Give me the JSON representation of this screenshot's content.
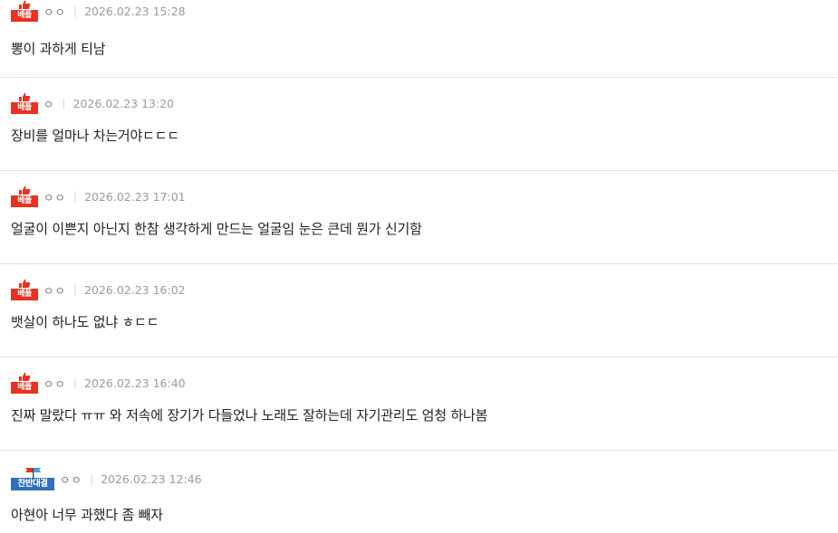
{
  "comments": [
    {
      "badge": "베플",
      "badge_type": "best",
      "nick": "ㅇㅇ",
      "date": "2026.02.23 15:28",
      "text": "뽕이 과하게 티남"
    },
    {
      "badge": "베플",
      "badge_type": "best",
      "nick": "ㅇ",
      "date": "2026.02.23 13:20",
      "text": "장비를 얼마나 차는거야ㄷㄷㄷ"
    },
    {
      "badge": "베플",
      "badge_type": "best",
      "nick": "ㅇㅇ",
      "date": "2026.02.23 17:01",
      "text": "얼굴이 이쁜지 아닌지 한참 생각하게 만드는 얼굴임 눈은 큰데 뭔가 신기함"
    },
    {
      "badge": "베플",
      "badge_type": "best",
      "nick": "ㅇㅇ",
      "date": "2026.02.23 16:02",
      "text": "뱃살이 하나도 없냐 ㅎㄷㄷ"
    },
    {
      "badge": "베플",
      "badge_type": "best",
      "nick": "ㅇㅇ",
      "date": "2026.02.23 16:40",
      "text": "진짜 말랐다 ㅠㅠ 와 저속에 장기가 다들었나 노래도 잘하는데 자기관리도 엄청 하나봄"
    },
    {
      "badge": "찬반대결",
      "badge_type": "debate",
      "nick": "ㅇㅇ",
      "date": "2026.02.23 12:46",
      "text": "아현아 너무 과했다 좀 빼자"
    }
  ],
  "colors": {
    "best_badge": "#e8321f",
    "debate_badge": "#2f6fbd",
    "debate_flag": "#3aa0e6"
  },
  "icons": {
    "best": "thumbs-up-icon",
    "debate": "flags-icon"
  }
}
